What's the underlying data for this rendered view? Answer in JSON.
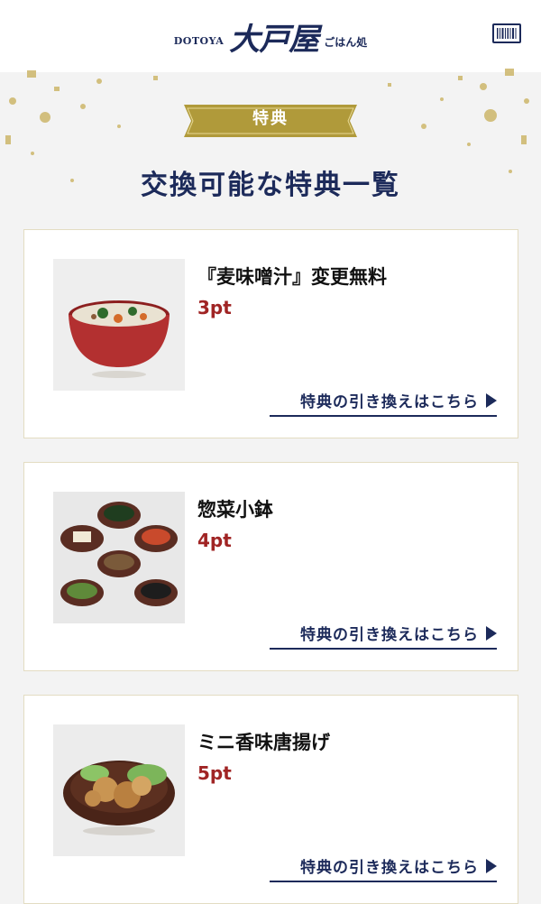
{
  "header": {
    "logo_en": "DOTOYA",
    "logo_jp": "大戸屋",
    "logo_sub": "ごはん処",
    "barcode_icon": "barcode-icon"
  },
  "hero": {
    "ribbon_label": "特典",
    "title": "交換可能な特典一覧"
  },
  "benefits": [
    {
      "name": "『麦味噌汁』変更無料",
      "points": "3pt",
      "link": "特典の引き換えはこちら",
      "image": "miso-soup-image"
    },
    {
      "name": "惣菜小鉢",
      "points": "4pt",
      "link": "特典の引き換えはこちら",
      "image": "side-dishes-image"
    },
    {
      "name": "ミニ香味唐揚げ",
      "points": "5pt",
      "link": "特典の引き換えはこちら",
      "image": "fried-chicken-image"
    }
  ],
  "colors": {
    "navy": "#1c2a5a",
    "gold": "#b09a3a",
    "points_red": "#a02424"
  }
}
